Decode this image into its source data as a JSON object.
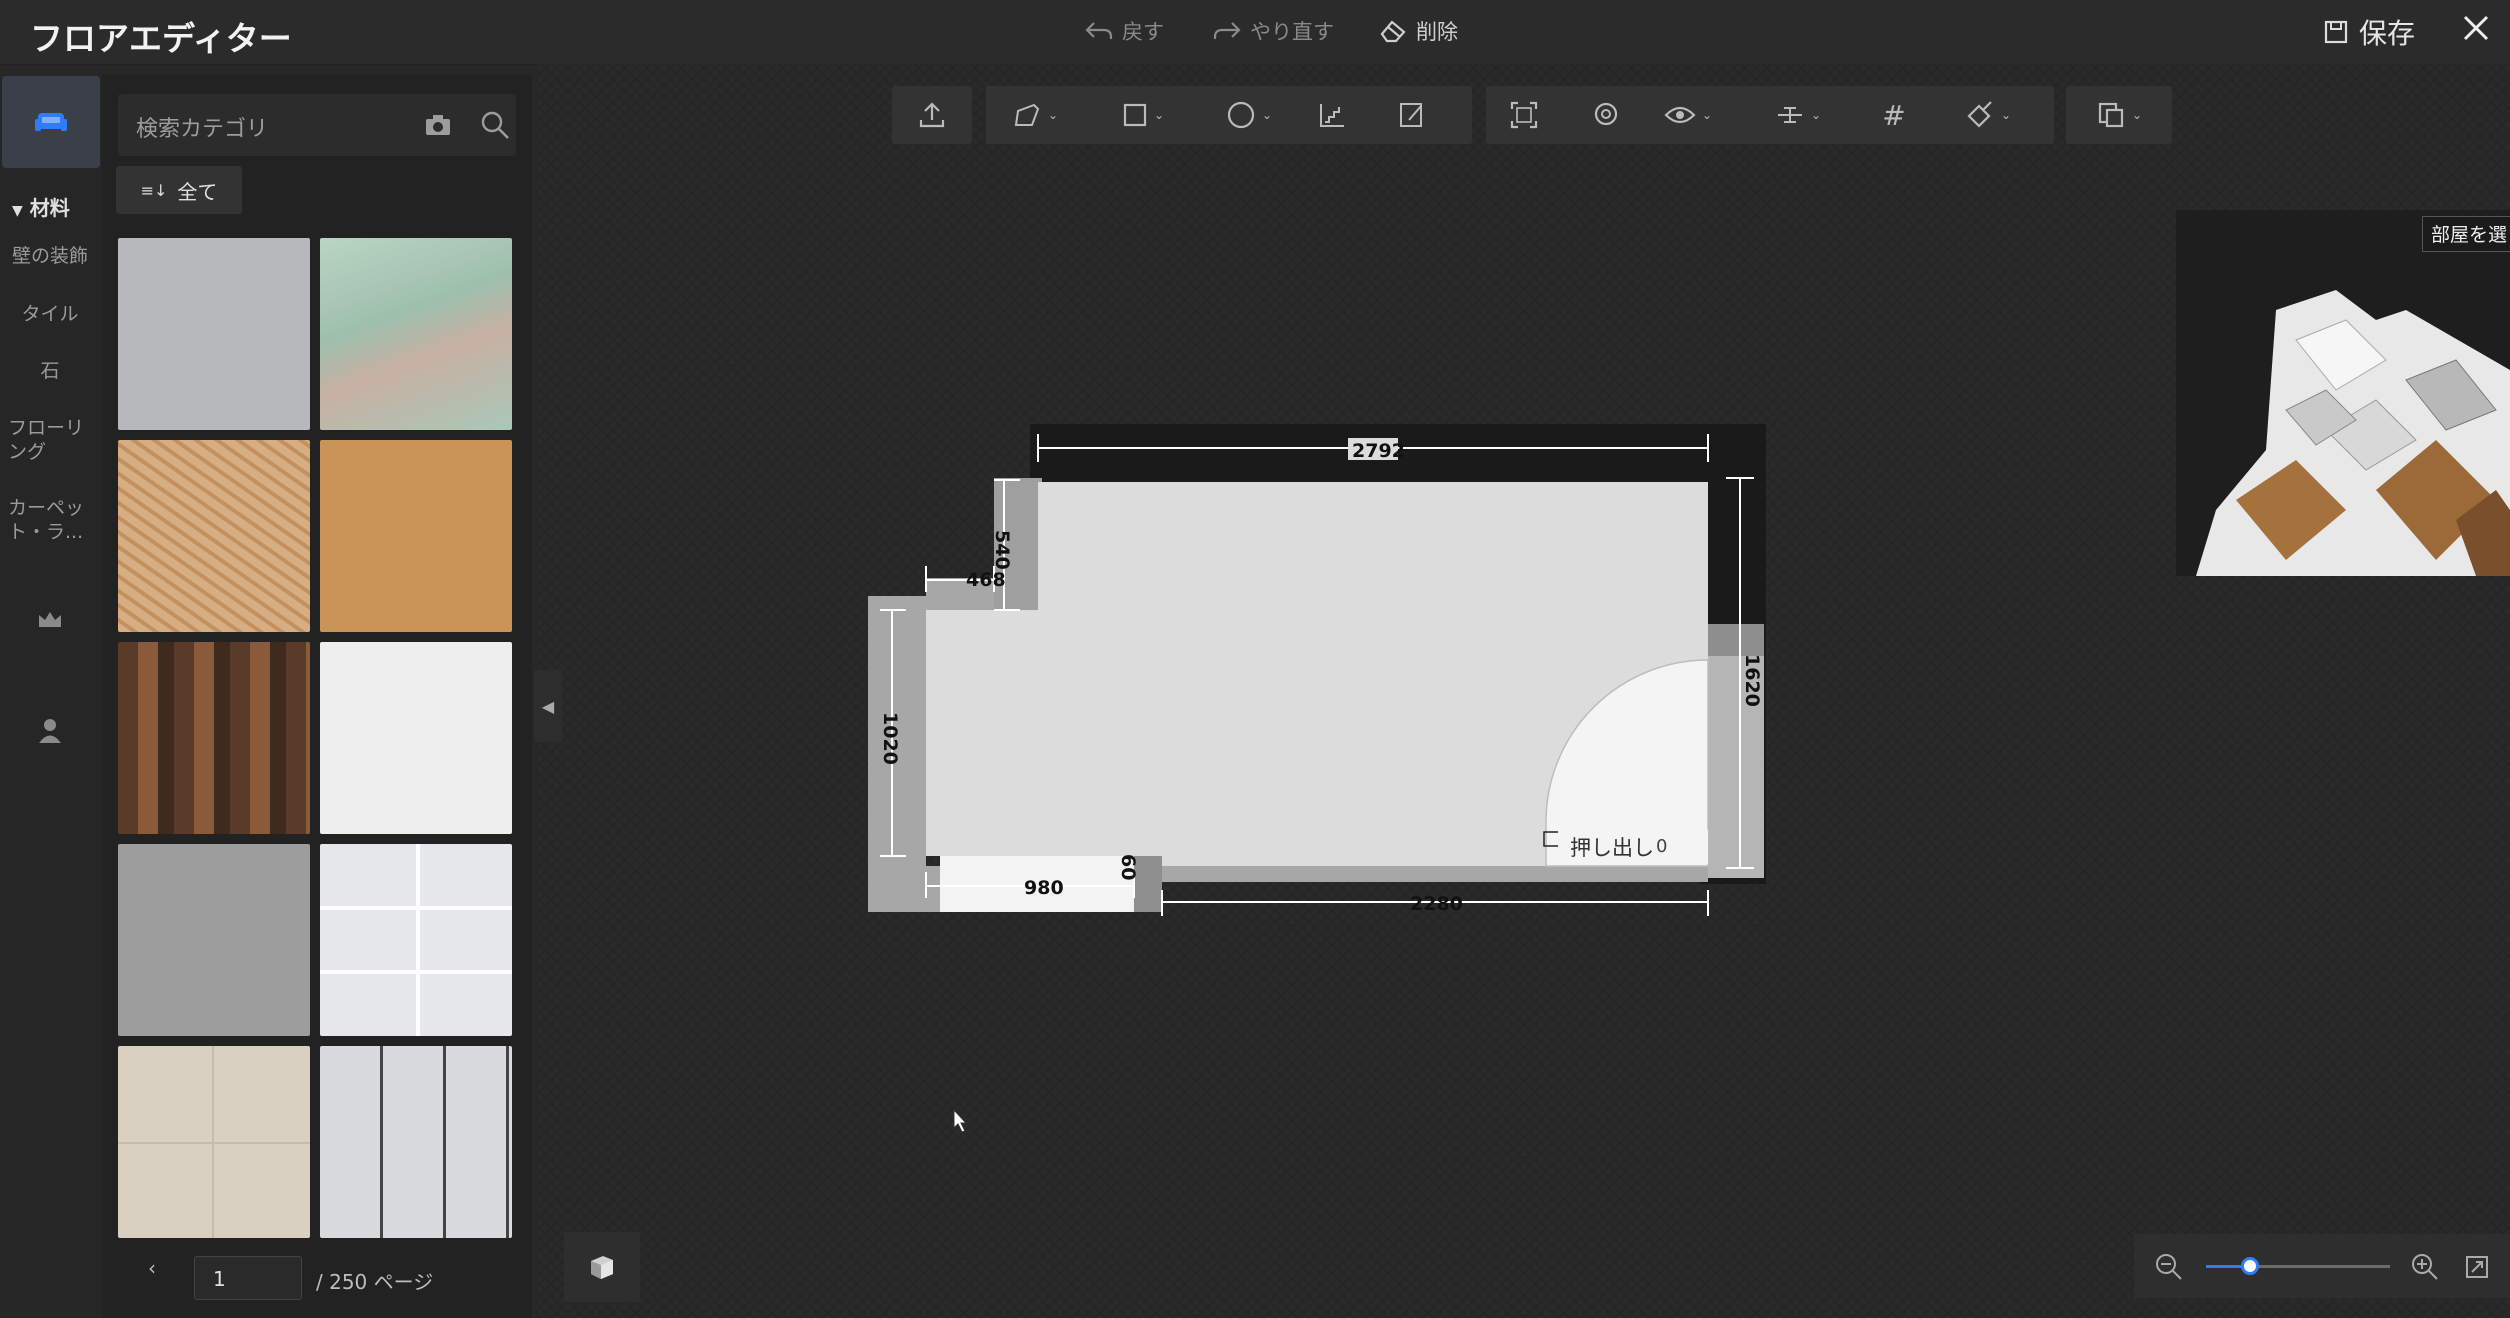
{
  "window": {
    "title": "フロアエディター",
    "save_label": "保存"
  },
  "top_actions": {
    "undo": "戻す",
    "redo": "やり直す",
    "delete": "削除"
  },
  "rail": {
    "section": "材料",
    "items": [
      "壁の装飾",
      "タイル",
      "石",
      "フローリング",
      "カーペット・ラ..."
    ]
  },
  "panel": {
    "search_placeholder": "検索カテゴリ",
    "filter_label": "全て",
    "tiles": [
      {
        "name": "gray-concrete",
        "color": "#b7b8bc"
      },
      {
        "name": "green-marble",
        "color": "#a9c8b7"
      },
      {
        "name": "woven-wood",
        "color": "#d2a77d"
      },
      {
        "name": "oak-plain",
        "color": "#c89458"
      },
      {
        "name": "brick-mosaic",
        "color": "#6e4a34"
      },
      {
        "name": "white-marble",
        "color": "#eeeeee"
      },
      {
        "name": "gray-stone",
        "color": "#9d9d9e"
      },
      {
        "name": "white-tile-grid",
        "color": "#e6e7ea"
      },
      {
        "name": "beige-tile",
        "color": "#d9d0c2"
      },
      {
        "name": "marble-tile-grid",
        "color": "#c9cccd"
      }
    ],
    "page": {
      "current": "1",
      "total_label": "/ 250 ページ"
    }
  },
  "minimap": {
    "select_room": "部屋を選"
  },
  "floorplan": {
    "dims": {
      "top": "2792",
      "left_short": "540",
      "step": "468",
      "left": "1020",
      "right": "1620",
      "bottom_left": "980",
      "bottom_gap": "60",
      "bottom_right": "2280"
    },
    "extrude_label": "押し出し",
    "extrude_value": "0"
  },
  "zoom": {
    "level": 0.24
  },
  "colors": {
    "accent": "#2f7df6",
    "room_fill": "#dcdcdc",
    "wall": "#9a9a9a"
  }
}
